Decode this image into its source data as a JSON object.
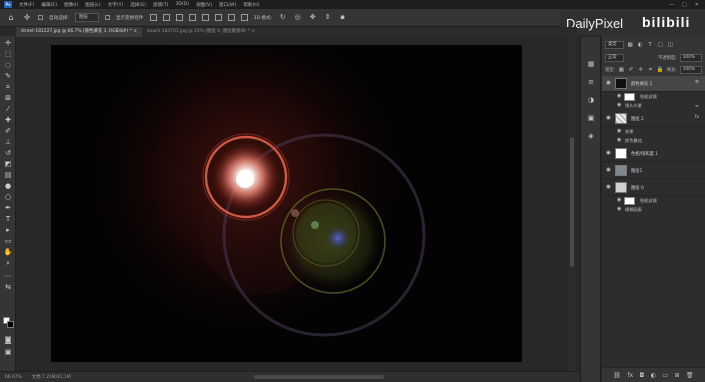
{
  "app": {
    "logo": "Ps"
  },
  "menu": [
    "文件(F)",
    "编辑(E)",
    "图像(I)",
    "图层(L)",
    "文字(Y)",
    "选择(S)",
    "滤镜(T)",
    "3D(D)",
    "视图(V)",
    "窗口(W)",
    "帮助(H)"
  ],
  "window_controls": [
    "—",
    "□",
    "✕"
  ],
  "options": {
    "auto_select": "自动选择:",
    "layer_dropdown": "图层",
    "show_transform": "显示变换控件",
    "mode_3d": "3D 模式:"
  },
  "watermark": {
    "site": "DailyPixel",
    "bili": "bilibili"
  },
  "tabs": [
    {
      "label": "street-181227.jpg @ 66.7% (颜色填充 1, RGB/8#) * ×",
      "active": true
    },
    {
      "label": "beach-183701.jpg @ 25% (图层 0, 图层蒙版/8) * ×",
      "active": false
    }
  ],
  "status": {
    "zoom": "66.67%",
    "doc": "文档:7.22M/42.1M"
  },
  "layers_panel": {
    "kind": "类型",
    "blend": "正常",
    "opacity_label": "不透明度:",
    "opacity": "100%",
    "lock_label": "锁定:",
    "fill_label": "填充:",
    "fill": "100%"
  },
  "layers": [
    {
      "name": "颜色填充 1",
      "thumb": "#111111",
      "selected": true,
      "fx": "⚙"
    },
    {
      "name": "智能滤镜",
      "sub": true,
      "white": true
    },
    {
      "name": "镜头光晕",
      "sub": true,
      "fx": "⚌"
    },
    {
      "name": "图层 2",
      "thumb": "#bbbbbb",
      "selected": false,
      "fx": "fx"
    },
    {
      "name": "效果",
      "sub": true
    },
    {
      "name": "颜色叠加",
      "sub": true
    },
    {
      "name": "色相/饱和度 1",
      "thumb": "#ffffff",
      "selected": false
    },
    {
      "name": "图层1",
      "thumb": "#7a8a90",
      "selected": false
    },
    {
      "name": "图层 0",
      "thumb": "#cfcfcf",
      "selected": false
    },
    {
      "name": "智能滤镜",
      "sub": true,
      "white": true
    },
    {
      "name": "模糊画廊",
      "sub": true
    }
  ],
  "footer_icons": [
    "link",
    "fx",
    "mask",
    "adjust",
    "folder",
    "new",
    "trash"
  ]
}
